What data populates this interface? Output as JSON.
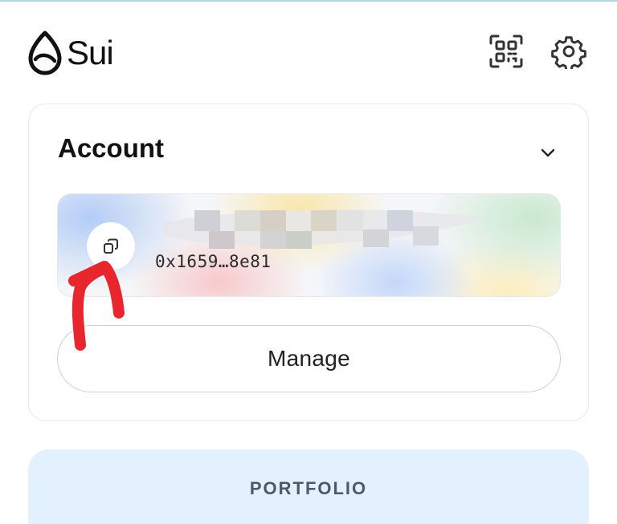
{
  "header": {
    "logo_text": "Sui",
    "icons": [
      "sui-drop-logo-icon",
      "qr-code-icon",
      "gear-icon"
    ]
  },
  "account": {
    "title": "Account",
    "address": "0x1659…8e81",
    "name_obscured": true,
    "manage_label": "Manage",
    "icons": [
      "chevron-down-icon",
      "copy-icon"
    ]
  },
  "portfolio": {
    "label": "PORTFOLIO"
  },
  "annotation": {
    "type": "red-arrow",
    "color": "#e8262e",
    "points_to": "copy-button"
  },
  "colors": {
    "portfolio_bg": "#e3f0fd",
    "card_border": "#e6e8ec",
    "manage_border": "#c9d2d8",
    "text": "#111111"
  }
}
